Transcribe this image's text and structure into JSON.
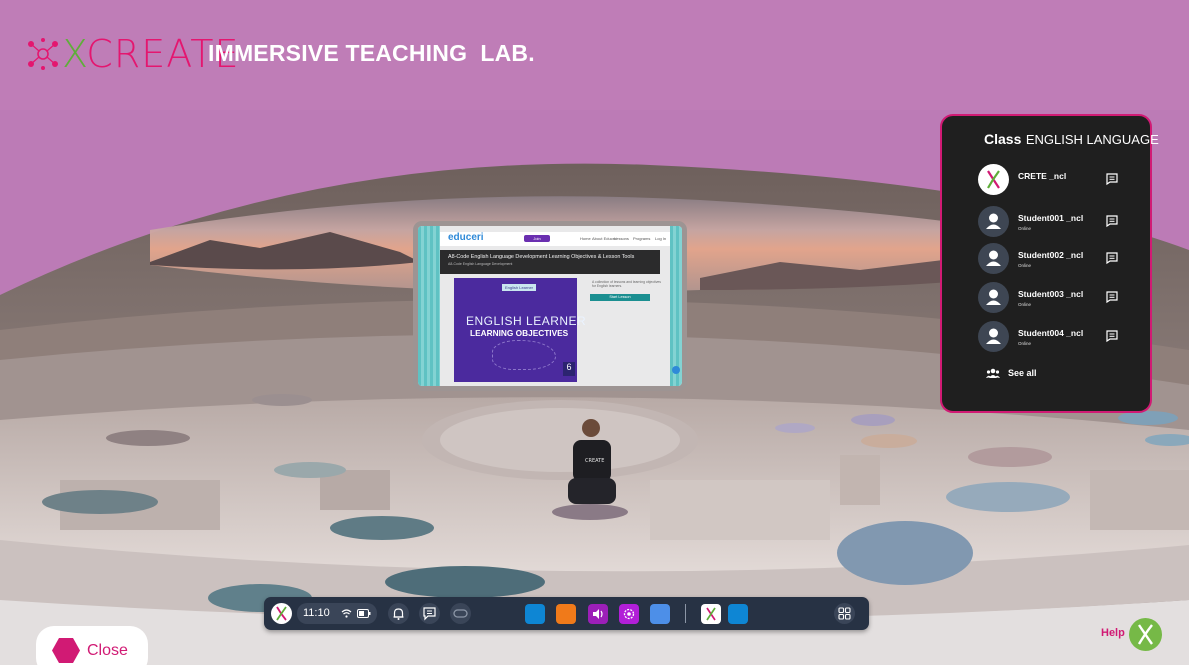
{
  "header": {
    "logo_text": "CREATE",
    "logo_x": "X",
    "tagline": "IMMERSIVE TEACHING  LAB."
  },
  "web_screen": {
    "brand": "educeri",
    "nav_links": [
      "Home",
      "About Educeri",
      "Lessons",
      "Programs",
      "Log In"
    ],
    "nav_button": "Join",
    "banner_title": "A8-Code English Language Development Learning Objectives & Lesson Tools",
    "banner_sub": "A8-Code English Language Development",
    "book_tag": "English Learner",
    "book_title_line1": "ENGLISH LEARNER",
    "book_title_line2": "LEARNING OBJECTIVES",
    "book_number": "6",
    "cta_button": "Start Lesson",
    "side_text": "A collection of lessons and learning objectives for English learners."
  },
  "class_panel": {
    "label": "Class",
    "name": "ENGLISH LANGUAGE",
    "members": [
      {
        "name": "CRETE _ncl",
        "status": ""
      },
      {
        "name": "Student001 _ncl",
        "status": "Online"
      },
      {
        "name": "Student002 _ncl",
        "status": "Online"
      },
      {
        "name": "Student003 _ncl",
        "status": "Online"
      },
      {
        "name": "Student004 _ncl",
        "status": "Online"
      }
    ],
    "see_all": "See all"
  },
  "taskbar": {
    "time": "11:10",
    "apps": [
      {
        "icon": "blue-app-icon",
        "color": "#0e86d4"
      },
      {
        "icon": "orange-app-icon",
        "color": "#f07a1a"
      },
      {
        "icon": "audio-app-icon",
        "color": "#9c1fb8"
      },
      {
        "icon": "settings-app-icon",
        "color": "#b21fd8"
      },
      {
        "icon": "light-blue-app-icon",
        "color": "#4d8fe8"
      }
    ],
    "pinned": [
      {
        "icon": "xcreate-app-icon",
        "color": "#ffffff"
      },
      {
        "icon": "blue-square-app-icon",
        "color": "#0e86d4"
      }
    ]
  },
  "close_button": {
    "label": "Close"
  },
  "help": {
    "label": "Help"
  },
  "colors": {
    "brand_pink": "#d11a74",
    "brand_green": "#5fae3a",
    "header_bg": "#bf7db7",
    "panel_bg": "#1f1f1f",
    "taskbar_bg": "#273244"
  }
}
